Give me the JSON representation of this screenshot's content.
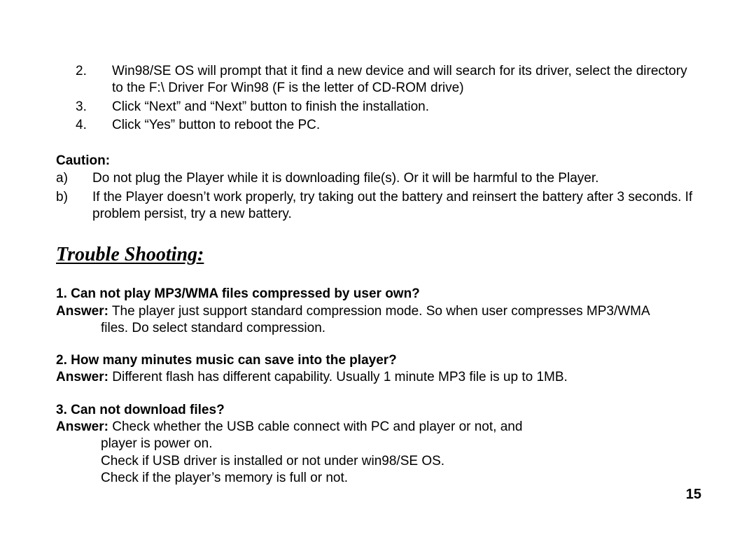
{
  "numbered": [
    {
      "n": "2.",
      "text": "Win98/SE OS will prompt that it find a new device and will search for its driver, select the directory to the F:\\ Driver For Win98 (F is the letter of CD-ROM drive)"
    },
    {
      "n": "3.",
      "text": "Click “Next” and “Next” button to finish the installation."
    },
    {
      "n": "4.",
      "text": "Click “Yes” button to reboot the PC."
    }
  ],
  "caution_label": "Caution:",
  "caution": [
    {
      "l": "a)",
      "text": "Do not plug the Player while it is downloading file(s). Or it will be harmful to the Player."
    },
    {
      "l": "b)",
      "text": "If the Player doesn’t work properly, try taking out the battery and reinsert the battery after 3 seconds. If problem persist, try a new battery."
    }
  ],
  "section_title": "Trouble Shooting:",
  "qa": [
    {
      "q": "1. Can not play MP3/WMA files compressed by user own?",
      "a_label": "Answer:",
      "a_first": " The player just support standard compression mode. So when user compresses MP3/WMA",
      "a_rest": [
        "files. Do select standard compression."
      ]
    },
    {
      "q": "2. How many minutes music can save into the player?",
      "a_label": "Answer:",
      "a_first": " Different flash has different capability. Usually 1 minute MP3 file is up to 1MB.",
      "a_rest": []
    },
    {
      "q": "3. Can not download files?",
      "a_label": "Answer:",
      "a_first": " Check whether the USB cable connect with PC and player or not, and",
      "a_rest": [
        "player is power on.",
        "Check if USB driver is installed or not under win98/SE OS.",
        "Check if the player’s memory is full or not."
      ]
    }
  ],
  "page_number": "15"
}
